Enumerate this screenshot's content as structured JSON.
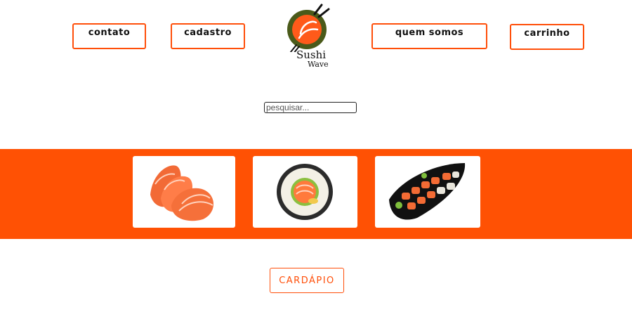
{
  "nav": {
    "contato": "contato",
    "cadastro": "cadastro",
    "quem_somos": "quem somos",
    "carrinho": "carrinho"
  },
  "logo": {
    "line1": "Sushi",
    "line2": "Wave"
  },
  "search": {
    "placeholder": "pesquisar...",
    "value": ""
  },
  "gallery": {
    "items": [
      "salmon-sashimi-image",
      "sushi-roll-image",
      "sushi-boat-platter-image"
    ]
  },
  "menu": {
    "button_label": "CARDÁPIO"
  },
  "colors": {
    "accent": "#ff5104",
    "logo_green": "#4a5a1a",
    "text": "#111111"
  }
}
